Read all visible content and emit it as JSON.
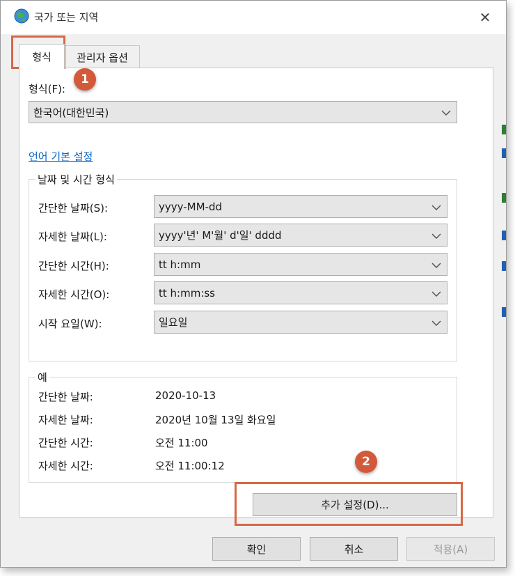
{
  "window": {
    "title": "국가 또는 지역",
    "close_label": "✕"
  },
  "tabs": [
    {
      "label": "형식"
    },
    {
      "label": "관리자 옵션"
    }
  ],
  "format": {
    "label": "형식(F):",
    "value": "한국어(대한민국)"
  },
  "language_link": "언어 기본 설정",
  "datetime_group": {
    "title": "날짜 및 시간 형식",
    "rows": [
      {
        "label": "간단한 날짜(S):",
        "value": "yyyy-MM-dd"
      },
      {
        "label": "자세한 날짜(L):",
        "value": "yyyy'년' M'월' d'일' dddd"
      },
      {
        "label": "간단한 시간(H):",
        "value": "tt h:mm"
      },
      {
        "label": "자세한 시간(O):",
        "value": "tt h:mm:ss"
      },
      {
        "label": "시작 요일(W):",
        "value": "일요일"
      }
    ]
  },
  "example_group": {
    "title": "예",
    "rows": [
      {
        "label": "간단한 날짜:",
        "value": "2020-10-13"
      },
      {
        "label": "자세한 날짜:",
        "value": "2020년 10월 13일 화요일"
      },
      {
        "label": "간단한 시간:",
        "value": "오전 11:00"
      },
      {
        "label": "자세한 시간:",
        "value": "오전 11:00:12"
      }
    ]
  },
  "additional_settings_button": "추가 설정(D)...",
  "footer": {
    "ok": "확인",
    "cancel": "취소",
    "apply": "적용(A)"
  },
  "annotations": {
    "marker1": "1",
    "marker2": "2",
    "highlight_color": "#d76845",
    "marker_color": "#d2593a"
  },
  "colors": {
    "link": "#0563c1",
    "window_bg": "#f0f0f0"
  }
}
